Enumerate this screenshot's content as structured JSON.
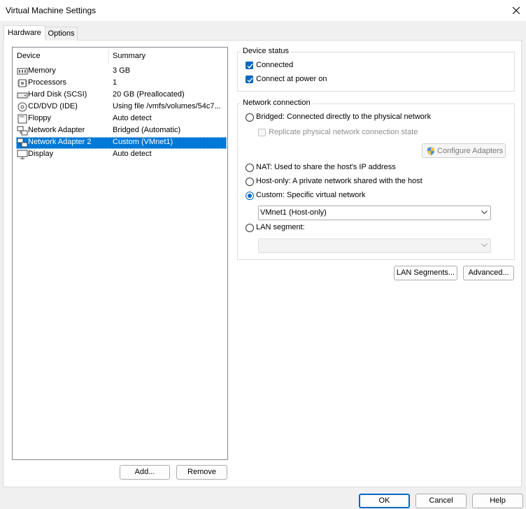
{
  "window": {
    "title": "Virtual Machine Settings",
    "close_icon": "close-icon"
  },
  "tabs": [
    {
      "label": "Hardware",
      "active": true
    },
    {
      "label": "Options",
      "active": false
    }
  ],
  "device_list": {
    "columns": [
      "Device",
      "Summary"
    ],
    "rows": [
      {
        "device": "Memory",
        "summary": "3 GB",
        "icon": "memory-icon"
      },
      {
        "device": "Processors",
        "summary": "1",
        "icon": "processor-icon"
      },
      {
        "device": "Hard Disk (SCSI)",
        "summary": "20 GB (Preallocated)",
        "icon": "hard-disk-icon"
      },
      {
        "device": "CD/DVD (IDE)",
        "summary": "Using file /vmfs/volumes/54c7...",
        "icon": "cd-dvd-icon"
      },
      {
        "device": "Floppy",
        "summary": "Auto detect",
        "icon": "floppy-icon"
      },
      {
        "device": "Network Adapter",
        "summary": "Bridged (Automatic)",
        "icon": "network-adapter-icon"
      },
      {
        "device": "Network Adapter 2",
        "summary": "Custom (VMnet1)",
        "icon": "network-adapter-icon",
        "selected": true
      },
      {
        "device": "Display",
        "summary": "Auto detect",
        "icon": "display-icon"
      }
    ],
    "add_label": "Add...",
    "remove_label": "Remove"
  },
  "device_status": {
    "title": "Device status",
    "connected_label": "Connected",
    "connected_checked": true,
    "connect_at_power_on_label": "Connect at power on",
    "connect_at_power_on_checked": true
  },
  "network_connection": {
    "title": "Network connection",
    "bridged_label": "Bridged: Connected directly to the physical network",
    "replicate_label": "Replicate physical network connection state",
    "configure_adapters_label": "Configure Adapters",
    "nat_label": "NAT: Used to share the host's IP address",
    "host_only_label": "Host-only: A private network shared with the host",
    "custom_label": "Custom: Specific virtual network",
    "custom_value": "VMnet1 (Host-only)",
    "lan_segment_label": "LAN segment:",
    "lan_segment_value": "",
    "selected": "custom"
  },
  "lan_segments_label": "LAN Segments...",
  "advanced_label": "Advanced...",
  "footer": {
    "ok_label": "OK",
    "cancel_label": "Cancel",
    "help_label": "Help"
  },
  "colors": {
    "selection": "#0078d7",
    "accent": "#0067c0"
  }
}
